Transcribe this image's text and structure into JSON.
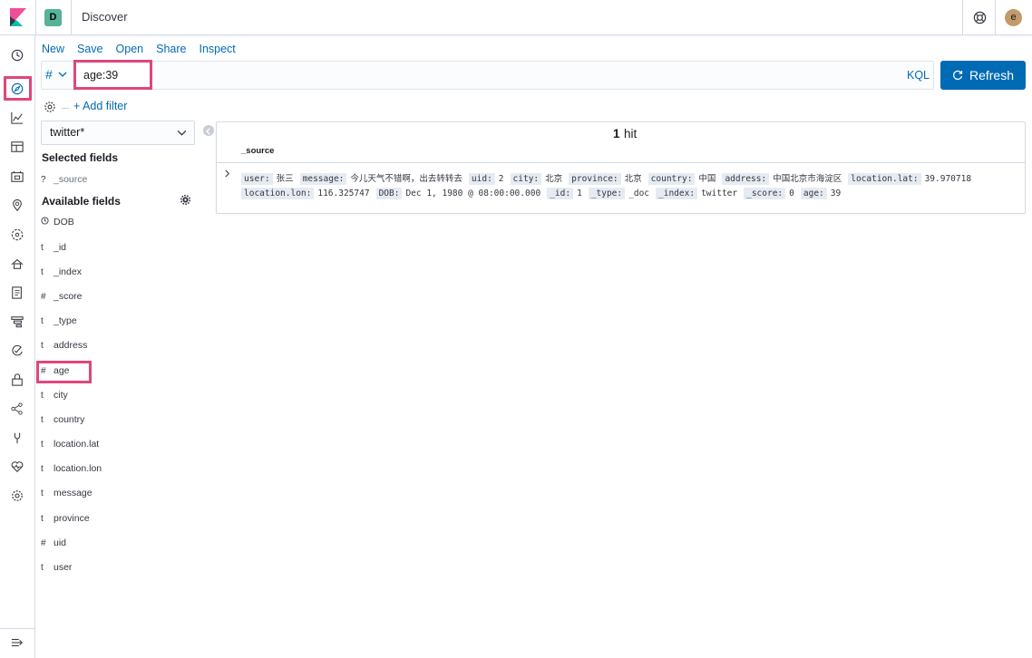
{
  "header": {
    "space_initial": "D",
    "app_title": "Discover",
    "user_initial": "e"
  },
  "nav": {
    "items": [
      "recently-viewed",
      "discover",
      "visualize",
      "dashboard",
      "canvas",
      "maps",
      "machine-learning",
      "infrastructure",
      "logs",
      "apm",
      "uptime",
      "siem",
      "graph",
      "dev-tools",
      "monitoring",
      "management"
    ]
  },
  "menu": {
    "new": "New",
    "save": "Save",
    "open": "Open",
    "share": "Share",
    "inspect": "Inspect"
  },
  "query": {
    "lang_icon": "#",
    "value": "age:39",
    "kql": "KQL",
    "refresh": "Refresh"
  },
  "filter": {
    "add_filter": "+ Add filter"
  },
  "sidebar": {
    "index_pattern": "twitter*",
    "selected_title": "Selected fields",
    "selected_fields": [
      {
        "type": "?",
        "name": "_source"
      }
    ],
    "available_title": "Available fields",
    "available_fields": [
      {
        "type": "clock",
        "name": "DOB"
      },
      {
        "type": "t",
        "name": "_id"
      },
      {
        "type": "t",
        "name": "_index"
      },
      {
        "type": "#",
        "name": "_score"
      },
      {
        "type": "t",
        "name": "_type"
      },
      {
        "type": "t",
        "name": "address"
      },
      {
        "type": "#",
        "name": "age"
      },
      {
        "type": "t",
        "name": "city"
      },
      {
        "type": "t",
        "name": "country"
      },
      {
        "type": "t",
        "name": "location.lat"
      },
      {
        "type": "t",
        "name": "location.lon"
      },
      {
        "type": "t",
        "name": "message"
      },
      {
        "type": "t",
        "name": "province"
      },
      {
        "type": "#",
        "name": "uid"
      },
      {
        "type": "t",
        "name": "user"
      }
    ]
  },
  "results": {
    "hit_count": "1",
    "hit_label": "hit",
    "column": "_source",
    "doc_line1": [
      {
        "key": "user:",
        "value": "张三"
      },
      {
        "key": "message:",
        "value": "今儿天气不错啊，出去转转去"
      },
      {
        "key": "uid:",
        "value": "2"
      },
      {
        "key": "city:",
        "value": "北京"
      },
      {
        "key": "province:",
        "value": "北京"
      },
      {
        "key": "country:",
        "value": "中国"
      },
      {
        "key": "address:",
        "value": "中国北京市海淀区"
      },
      {
        "key": "location.lat:",
        "value": "39.970718"
      }
    ],
    "doc_line2": [
      {
        "key": "location.lon:",
        "value": "116.325747"
      },
      {
        "key": "DOB:",
        "value": "Dec 1, 1980 @ 08:00:00.000"
      },
      {
        "key": "_id:",
        "value": "1"
      },
      {
        "key": "_type:",
        "value": "_doc"
      },
      {
        "key": "_index:",
        "value": "twitter"
      },
      {
        "key": "_score:",
        "value": "0"
      },
      {
        "key": "age:",
        "value": "39"
      }
    ]
  },
  "colors": {
    "accent": "#006bb4",
    "highlight": "#e0457b",
    "space": "#54b399"
  }
}
